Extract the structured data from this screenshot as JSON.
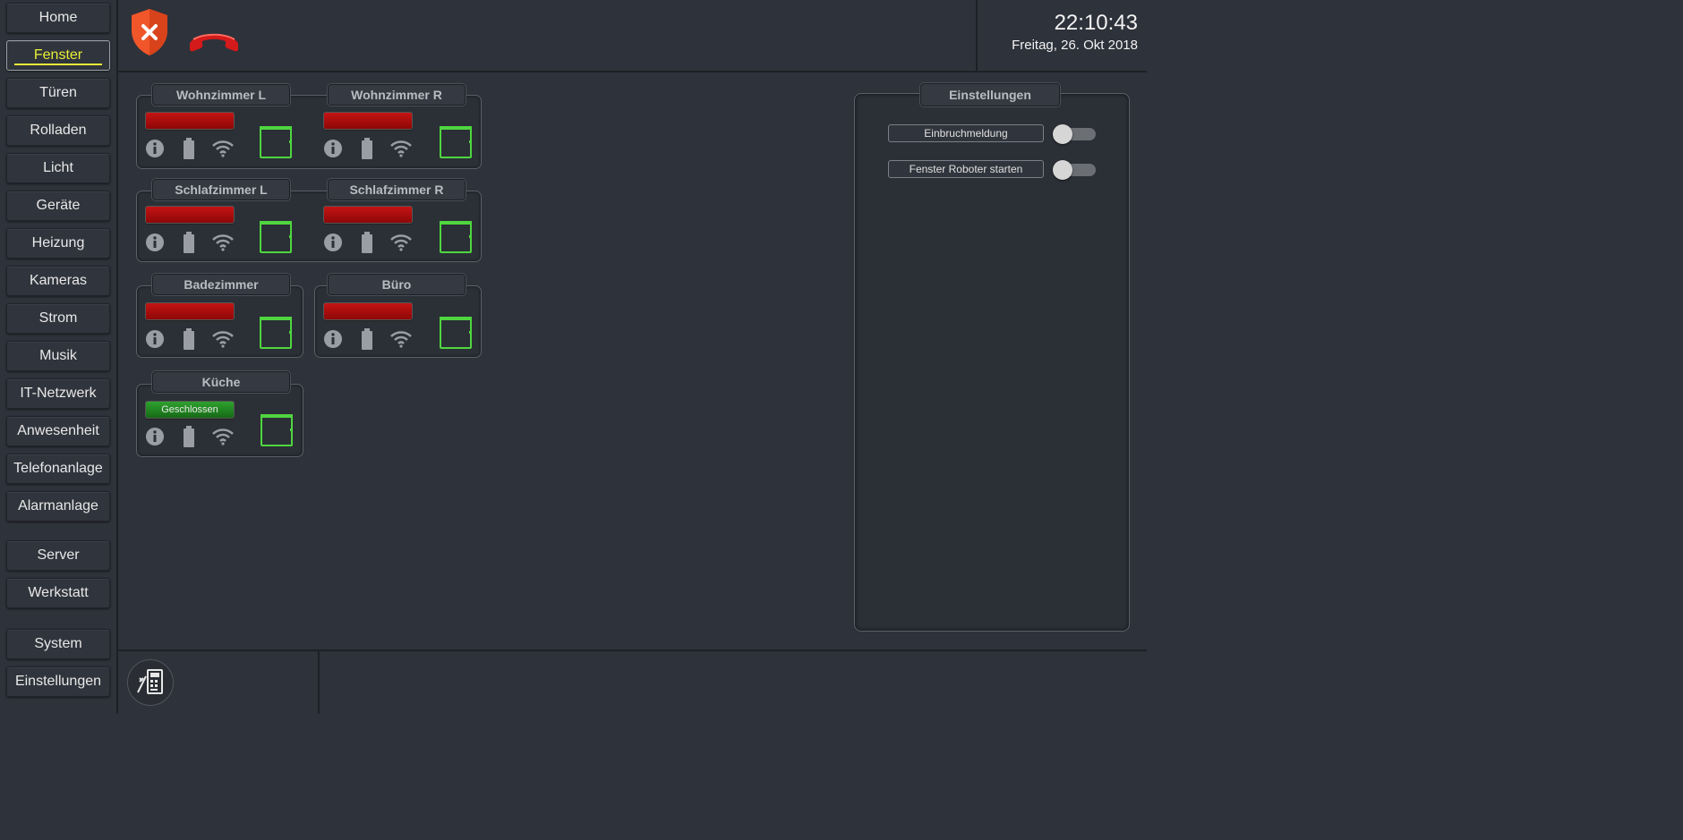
{
  "nav": {
    "items": [
      {
        "label": "Home"
      },
      {
        "label": "Fenster"
      },
      {
        "label": "Türen"
      },
      {
        "label": "Rolladen"
      },
      {
        "label": "Licht"
      },
      {
        "label": "Geräte"
      },
      {
        "label": "Heizung"
      },
      {
        "label": "Kameras"
      },
      {
        "label": "Strom"
      },
      {
        "label": "Musik"
      },
      {
        "label": "IT-Netzwerk"
      },
      {
        "label": "Anwesenheit"
      },
      {
        "label": "Telefonanlage"
      },
      {
        "label": "Alarmanlage"
      },
      {
        "label": "Server"
      },
      {
        "label": "Werkstatt"
      },
      {
        "label": "System"
      },
      {
        "label": "Einstellungen"
      }
    ],
    "active": "Fenster"
  },
  "header": {
    "time": "22:10:43",
    "date": "Freitag, 26. Okt 2018",
    "alarm_icon": "shield-x-icon",
    "phone_icon": "phone-hangup-icon",
    "alarm_color": "#f0562a",
    "phone_color": "#d41a1a"
  },
  "rooms": [
    {
      "name": "Wohnzimmer L",
      "status": ""
    },
    {
      "name": "Wohnzimmer R",
      "status": ""
    },
    {
      "name": "Schlafzimmer L",
      "status": ""
    },
    {
      "name": "Schlafzimmer R",
      "status": ""
    },
    {
      "name": "Badezimmer",
      "status": ""
    },
    {
      "name": "Büro",
      "status": ""
    },
    {
      "name": "Küche",
      "status": "Geschlossen"
    }
  ],
  "settings": {
    "title": "Einstellungen",
    "items": [
      {
        "label": "Einbruchmeldung",
        "enabled": false
      },
      {
        "label": "Fenster Roboter starten",
        "enabled": false
      }
    ]
  },
  "colors": {
    "open": "#c41414",
    "closed": "#2ea02e",
    "window_frame": "#4fd63f",
    "active_nav": "#e8ef37"
  }
}
